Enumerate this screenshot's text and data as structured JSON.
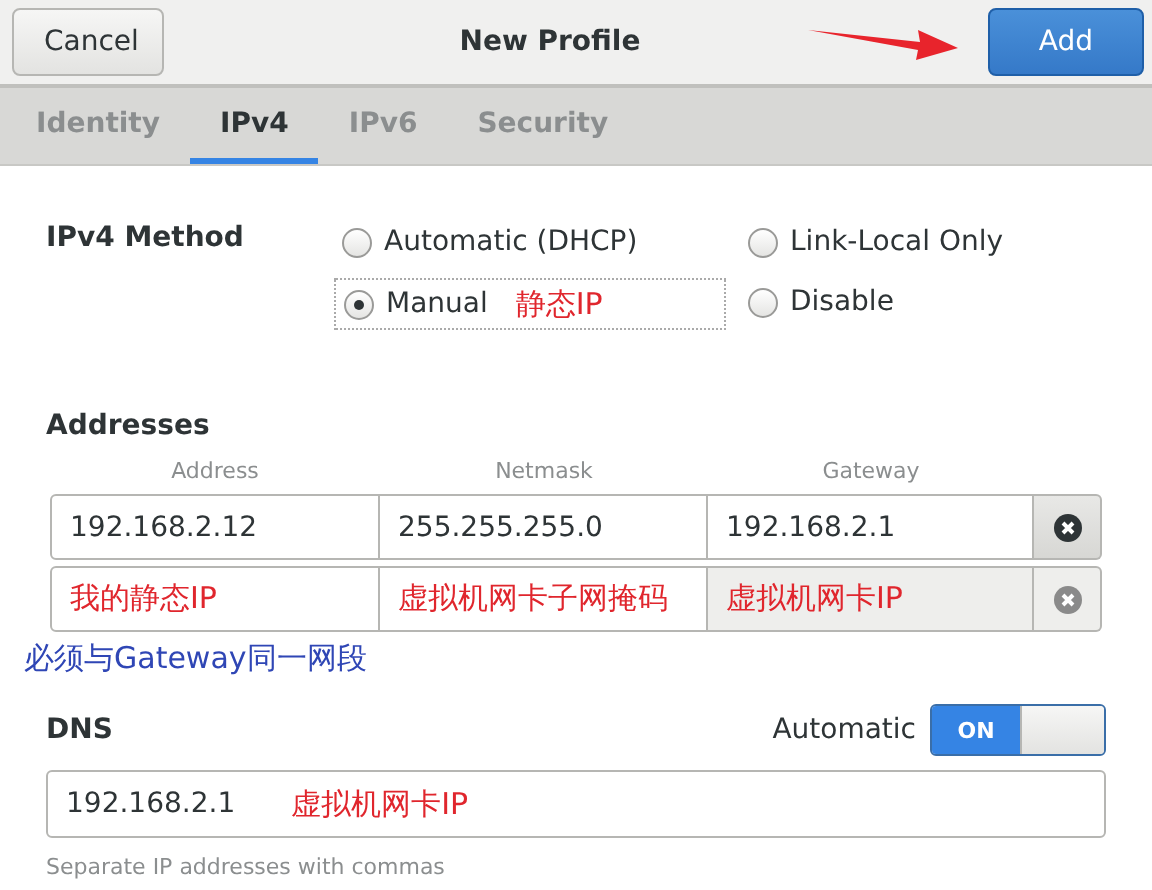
{
  "header": {
    "cancel": "Cancel",
    "title": "New Profile",
    "add": "Add",
    "arrow_annotation": true
  },
  "tabs": [
    {
      "label": "Identity",
      "selected": false
    },
    {
      "label": "IPv4",
      "selected": true
    },
    {
      "label": "IPv6",
      "selected": false
    },
    {
      "label": "Security",
      "selected": false
    }
  ],
  "method": {
    "label": "IPv4 Method",
    "options": [
      {
        "label": "Automatic (DHCP)",
        "selected": false
      },
      {
        "label": "Link-Local Only",
        "selected": false
      },
      {
        "label": "Manual",
        "selected": true,
        "note": "静态IP"
      },
      {
        "label": "Disable",
        "selected": false
      }
    ]
  },
  "addresses": {
    "title": "Addresses",
    "columns": [
      "Address",
      "Netmask",
      "Gateway"
    ],
    "rows": [
      {
        "cells": [
          "192.168.2.12",
          "255.255.255.0",
          "192.168.2.1"
        ],
        "kind": "value"
      },
      {
        "cells": [
          "我的静态IP",
          "虚拟机网卡子网掩码",
          "虚拟机网卡IP"
        ],
        "kind": "note"
      }
    ],
    "note": "必须与Gateway同一网段"
  },
  "dns": {
    "title": "DNS",
    "automatic_label": "Automatic",
    "automatic": {
      "on": true,
      "label": "ON"
    },
    "value": "192.168.2.1",
    "note": "虚拟机网卡IP",
    "hint": "Separate IP addresses with commas"
  }
}
